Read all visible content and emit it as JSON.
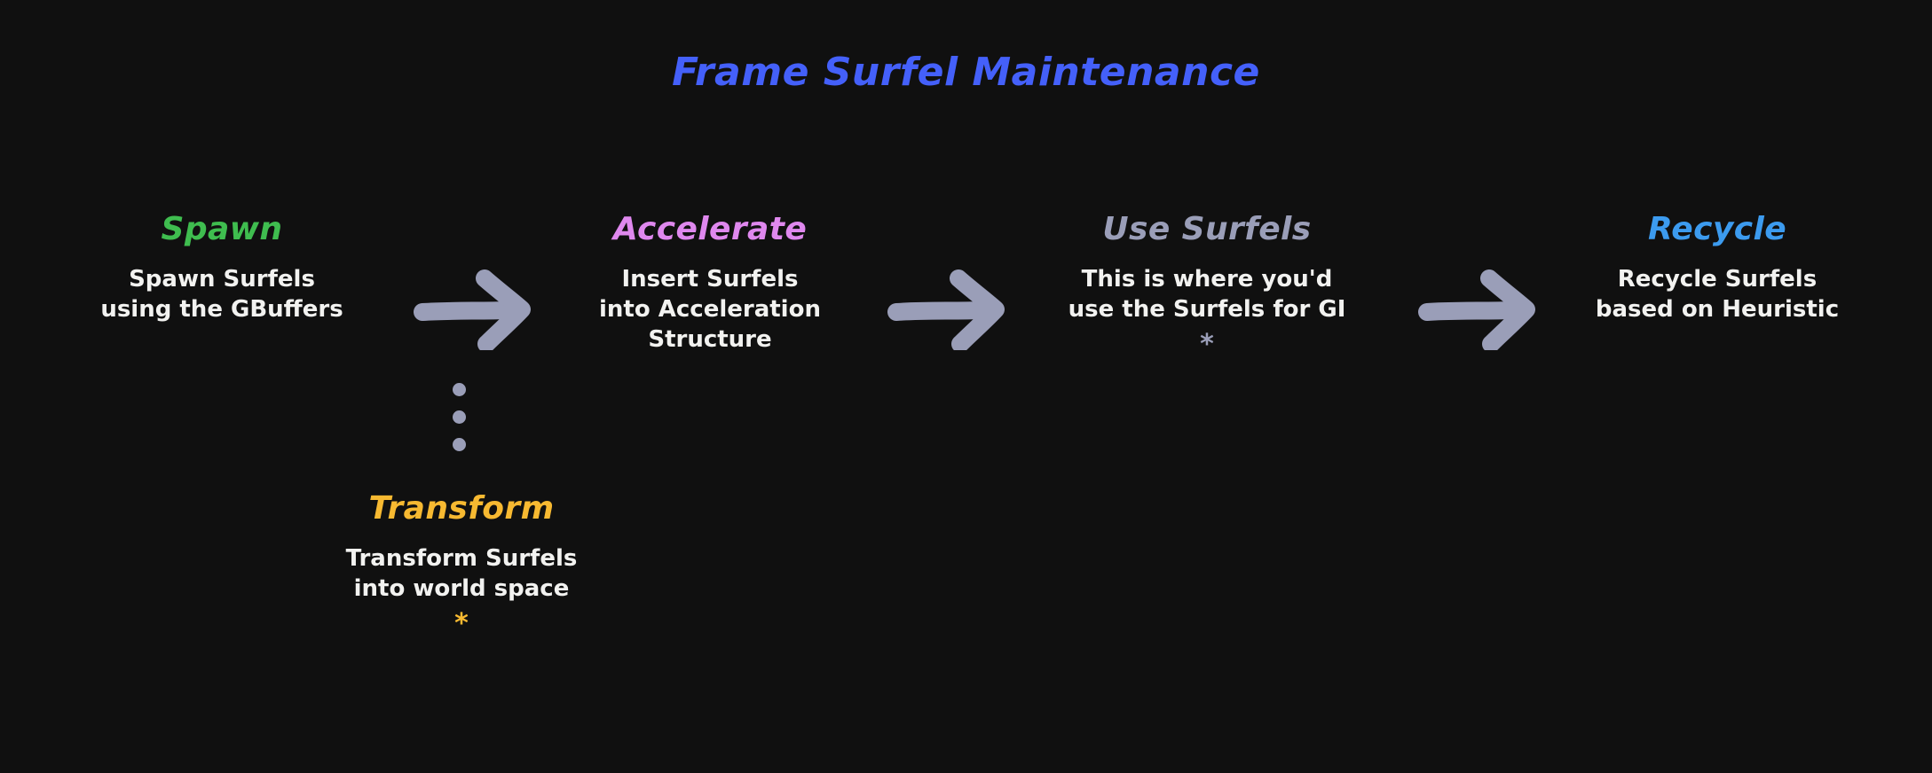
{
  "title": "Frame Surfel Maintenance",
  "colors": {
    "background": "#101010",
    "title": "#4460FA",
    "arrow": "#9A9EB8",
    "body_text": "#F2F2F0",
    "spawn": "#3FBD4F",
    "accelerate": "#DF88EE",
    "use_surfels": "#9A9EB8",
    "recycle": "#3C9BEF",
    "transform": "#F7B931"
  },
  "stages": [
    {
      "id": "spawn",
      "heading": "Spawn",
      "body": "Spawn Surfels\nusing the GBuffers",
      "note": ""
    },
    {
      "id": "accelerate",
      "heading": "Accelerate",
      "body": "Insert Surfels\ninto Acceleration\nStructure",
      "note": ""
    },
    {
      "id": "use-surfels",
      "heading": "Use Surfels",
      "body": "This is where you'd\nuse the Surfels for GI",
      "note": "*"
    },
    {
      "id": "recycle",
      "heading": "Recycle",
      "body": "Recycle Surfels\nbased on Heuristic",
      "note": ""
    }
  ],
  "branch": {
    "id": "transform",
    "heading": "Transform",
    "body": "Transform Surfels\ninto world space",
    "note": "*",
    "connector_dots": 3
  },
  "arrows": [
    {
      "id": "arrow-spawn-to-accelerate",
      "from": "spawn",
      "to": "accelerate"
    },
    {
      "id": "arrow-accelerate-to-use-surfels",
      "from": "accelerate",
      "to": "use-surfels"
    },
    {
      "id": "arrow-use-surfels-to-recycle",
      "from": "use-surfels",
      "to": "recycle"
    }
  ]
}
